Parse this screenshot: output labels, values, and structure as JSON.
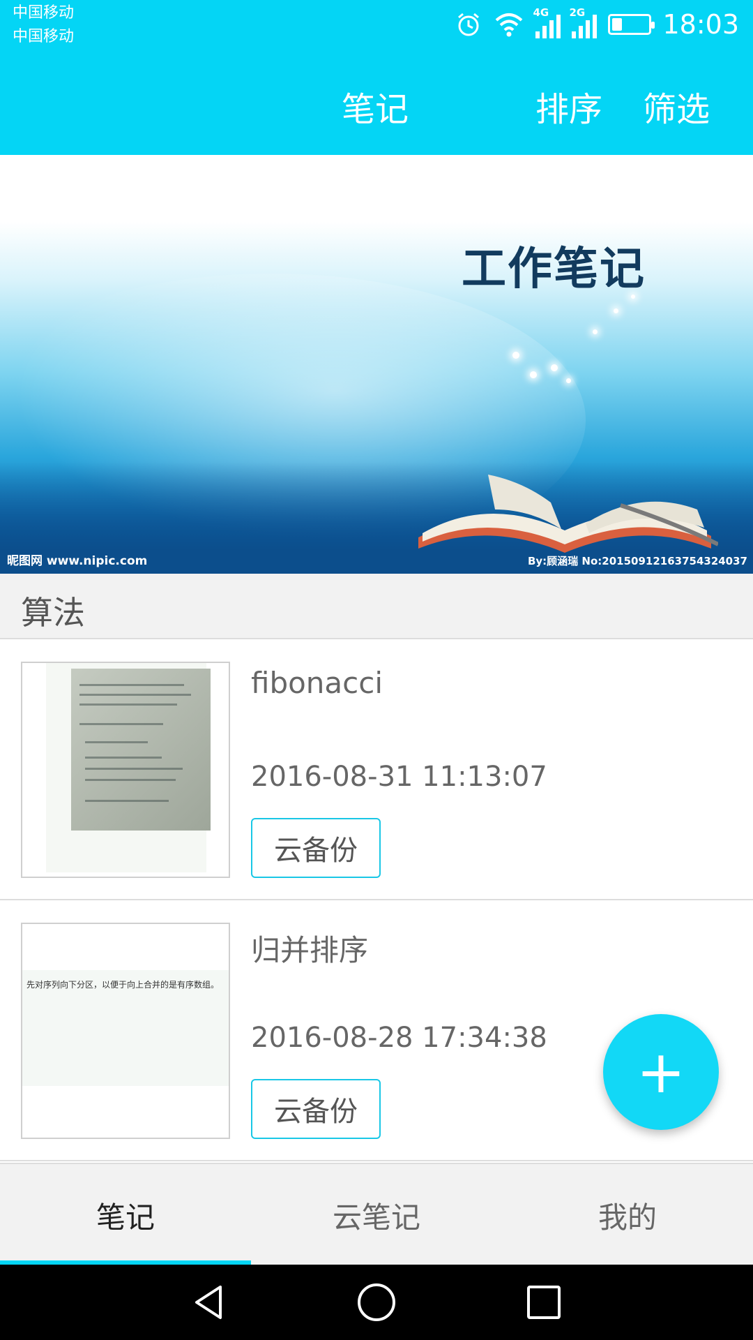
{
  "status_bar": {
    "carrier_1": "中国移动",
    "carrier_2": "中国移动",
    "network_1": "4G",
    "network_2": "2G",
    "time": "18:03"
  },
  "app_bar": {
    "title": "笔记",
    "sort": "排序",
    "filter": "筛选"
  },
  "banner": {
    "title": "工作笔记",
    "watermark_left": "昵图网 www.nipic.com",
    "watermark_right": "By:顾涵瑞 No:20150912163754324037"
  },
  "section": {
    "label": "算法"
  },
  "notes": [
    {
      "title": "fibonacci",
      "date": "2016-08-31 11:13:07",
      "backup_label": "云备份"
    },
    {
      "title": "归并排序",
      "date": "2016-08-28 17:34:38",
      "backup_label": "云备份",
      "thumb_text": "先对序列向下分区，以便于向上合并的是有序数组。"
    }
  ],
  "fab": {
    "label": "+"
  },
  "bottom_tabs": [
    {
      "label": "笔记",
      "selected": true
    },
    {
      "label": "云笔记",
      "selected": false
    },
    {
      "label": "我的",
      "selected": false
    }
  ],
  "colors": {
    "accent": "#04d5f5",
    "fab": "#12d8f6",
    "backup_border": "#19c7e6"
  }
}
